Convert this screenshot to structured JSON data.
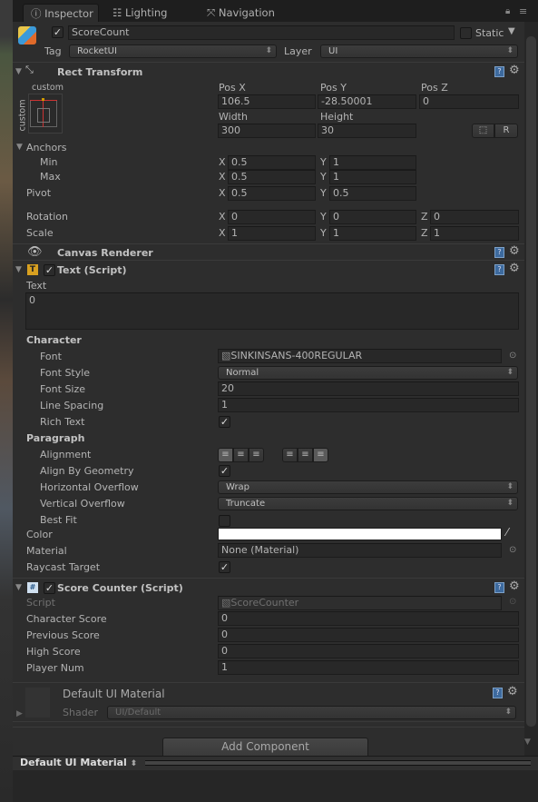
{
  "tabs": [
    {
      "label": "Inspector",
      "icon": "info-icon"
    },
    {
      "label": "Lighting",
      "icon": "sliders-icon"
    },
    {
      "label": "Navigation",
      "icon": "navigation-icon"
    }
  ],
  "object": {
    "name": "ScoreCount",
    "active": true,
    "static_label": "Static",
    "static": false,
    "tag_label": "Tag",
    "tag": "RocketUI",
    "layer_label": "Layer",
    "layer": "UI"
  },
  "rect_transform": {
    "title": "Rect Transform",
    "anchor_preset": "custom",
    "anchor_preset_side": "custom",
    "pos_x_label": "Pos X",
    "pos_y_label": "Pos Y",
    "pos_z_label": "Pos Z",
    "pos_x": "106.5",
    "pos_y": "-28.50001",
    "pos_z": "0",
    "width_label": "Width",
    "height_label": "Height",
    "width": "300",
    "height": "30",
    "raw_button": "R",
    "anchors_label": "Anchors",
    "min_label": "Min",
    "max_label": "Max",
    "pivot_label": "Pivot",
    "min_x": "0.5",
    "min_y": "1",
    "max_x": "0.5",
    "max_y": "1",
    "pivot_x": "0.5",
    "pivot_y": "0.5",
    "rotation_label": "Rotation",
    "scale_label": "Scale",
    "rot_x": "0",
    "rot_y": "0",
    "rot_z": "0",
    "scale_x": "1",
    "scale_y": "1",
    "scale_z": "1",
    "x": "X",
    "y": "Y",
    "z": "Z"
  },
  "canvas_renderer": {
    "title": "Canvas Renderer"
  },
  "text_script": {
    "title": "Text (Script)",
    "enabled": true,
    "text_label": "Text",
    "text": "0",
    "character_label": "Character",
    "font_label": "Font",
    "font": "SINKINSANS-400REGULAR",
    "font_style_label": "Font Style",
    "font_style": "Normal",
    "font_size_label": "Font Size",
    "font_size": "20",
    "line_spacing_label": "Line Spacing",
    "line_spacing": "1",
    "rich_text_label": "Rich Text",
    "rich_text": true,
    "paragraph_label": "Paragraph",
    "alignment_label": "Alignment",
    "align_by_geometry_label": "Align By Geometry",
    "align_by_geometry": true,
    "horizontal_overflow_label": "Horizontal Overflow",
    "horizontal_overflow": "Wrap",
    "vertical_overflow_label": "Vertical Overflow",
    "vertical_overflow": "Truncate",
    "best_fit_label": "Best Fit",
    "best_fit": false,
    "color_label": "Color",
    "color": "#ffffff",
    "material_label": "Material",
    "material": "None (Material)",
    "raycast_target_label": "Raycast Target",
    "raycast_target": true
  },
  "score_counter": {
    "title": "Score Counter (Script)",
    "enabled": true,
    "script_label": "Script",
    "script": "ScoreCounter",
    "character_score_label": "Character Score",
    "character_score": "0",
    "previous_score_label": "Previous Score",
    "previous_score": "0",
    "high_score_label": "High Score",
    "high_score": "0",
    "player_num_label": "Player Num",
    "player_num": "1"
  },
  "material": {
    "title": "Default UI Material",
    "shader_label": "Shader",
    "shader": "UI/Default"
  },
  "add_component": "Add Component",
  "preview": {
    "title": "Default UI Material"
  }
}
